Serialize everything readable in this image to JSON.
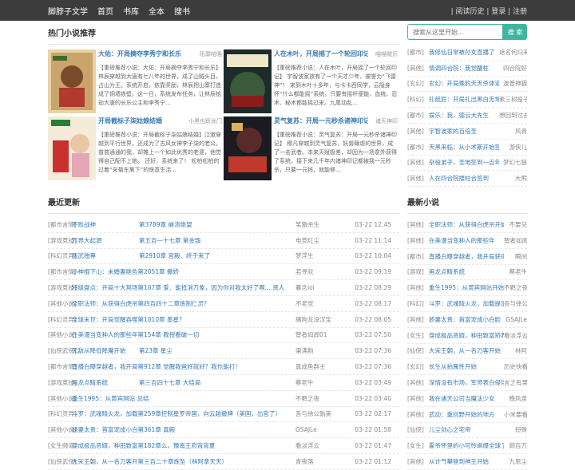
{
  "topbar": {
    "brand": "脚脖子文学",
    "nav": [
      "首页",
      "书库",
      "全本",
      "搜书"
    ],
    "right": "| 阅读历史 | 登录 | 注册"
  },
  "search": {
    "placeholder": "搜索从这里开始...",
    "button": "搜 索"
  },
  "hot": {
    "title": "热门小说推荐",
    "cards": [
      {
        "title": "大佑：开局摘夺李秀宁和长乐",
        "author": "吼罪哈晚",
        "desc": "【重磅推荐小说：大佑：开局摘夺李秀宁和长乐】 林辰穿越到大唐有七八年的世界，成了山贼头目，占山为王。系统开启，依靠奖励，林辰把山寨打造成了铜墙铁壁。这一日，系统发布任务，让林辰抢劫大唐的长乐公主和李秀宁..."
      },
      {
        "title": "人在木叶，开局摇了一个轮回印记",
        "author": "喵喵贼乐",
        "desc": "【重磅推荐小说：人在木叶，开局摇了一个轮回印记】 宇智波家族有了一个天才少年，被誉为“飞雷神”！ 来到木叶十多年，与卡卡西同学，云隐身怀“什么都能摇”系统，只要有摇杆便能，血统、忍术、秘术都能摇过来。九尾动乱..."
      },
      {
        "title": "开局截标子柒姑娘结婚",
        "author": "小黑也跃龙门",
        "desc": "【重磅推荐小说：开局截标子柒姑娘结婚】江澈穿越到平行世界，还成为了古风女神李子柒的老公。 普普通通的我，却摊上一个如此优秀的老婆，他觉得自己配不上她。 还好，系统来了！ 松柏松柏的过着“采菊东篱下”的惬意生活..."
      },
      {
        "title": "灵气复苏：开局一元秒杀诸神印记",
        "author": "诸天神印",
        "desc": "【重磅推荐小说：灵气复苏：开局一元秒杀诸神印记】 穆凡穿越到灵气复苏，妖兽肆虐的世界，成了一名武者。本来天赋极差，却因为一场意外获得了系统，接下来几千年内诸神印记都被我一元秒杀，只要一元钱，就能够..."
      }
    ]
  },
  "recent": {
    "title": "最近更新",
    "rows": [
      [
        "[都市言情]",
        "不败战神",
        "第3789章 崩溃绝望",
        "笑傲余生",
        "03-22 12:45"
      ],
      [
        "[游戏竞技]",
        "万界大起源",
        "第五百一十七章 第金毁",
        "电竞红尘",
        "03-22 11:14"
      ],
      [
        "[科幻灵异]",
        "医武独尊",
        "第2910章 宫殿、终于来了",
        "梦浮生",
        "03-22 10:04"
      ],
      [
        "[都市言情]",
        "小神棍下山：未婚妻绝色第2051章 撒娇",
        "",
        "若寻欢",
        "03-22 09:19"
      ],
      [
        "[游戏竞技]",
        "特级盘点：开局十大冥场第107章 爱、能抵消万象，因为你对我太好了啊....贤人",
        "",
        "暮念ioi",
        "03-22 08:29"
      ],
      [
        "[其他小说]",
        "全职法师：从获得白虎吊第四百四十二章炼制仁灵？",
        "",
        "不老觉",
        "03-22 08:17"
      ],
      [
        "[科幻灵异]",
        "全球末世：开局觉醒吞噬第1010章 墨星?",
        "",
        "猪狗龙没汉宝",
        "03-22 08:05"
      ],
      [
        "[其他小说]",
        "在美漫当变种人的那些年第154章 教授看破一切",
        "",
        "智者如闻01",
        "03-22 07:50"
      ],
      [
        "[仙侠武侠]",
        "无敌从降低降魔开始",
        "第23章 星尘",
        "渠沸韵",
        "03-22 07:36"
      ],
      [
        "[都市言情]",
        "直播白曝穿越者，我开局第912章 觉醒我爸好就好？我也能打！",
        "",
        "真成鱼群主",
        "03-22 07:36"
      ],
      [
        "[游戏竞技]",
        "画龙点睛系统",
        "第三百四十七章 大结局",
        "蔡老牛",
        "03-22 03:49"
      ],
      [
        "[其他小说]",
        "重生1995：从黄宾网站 总结",
        "",
        "不羁之夜",
        "03-22 03:40"
      ],
      [
        "[科幻灵异]",
        "斗罗：武魂晴火龙，加载第259章控制星罗帝国，向云越撤牌（美国，出宫了）",
        "",
        "吾与徐公孰美",
        "03-22 02:17"
      ],
      [
        "[其他小说]",
        "娇妻太贵：首富宠成小白第361章 真殿",
        "",
        "GSAJLe",
        "03-22 01:58"
      ],
      [
        "[女生频道]",
        "穿成极品恶婿，种田致富第182章么，豫南王府背背夏",
        "",
        "看淡浮云",
        "03-22 01:47"
      ],
      [
        "[仙侠武侠]",
        "大宋王朝，从一名刀客开第三百二十章炼坠（林阿拿天天）",
        "",
        "青夜落",
        "03-22 01:12"
      ]
    ]
  },
  "hotright": {
    "rows": [
      [
        "[都市]",
        "我修仙日常被孙女直播了",
        "遮名何归来"
      ],
      [
        "[其他]",
        "情调四合院：我觉醒柱",
        "四合院好"
      ],
      [
        "[玄幻]",
        "玄幻：开局乘豹天天杀体道胎",
        "波普神猫"
      ],
      [
        "[科幻]",
        "扎纸匠：开局扎出黑白无常",
        "素三树投子"
      ],
      [
        "[都市]",
        "娱乐：我，德云大先生",
        "想回到过去"
      ],
      [
        "[其他]",
        "宇智波家的百倍圣",
        "风青"
      ],
      [
        "[都市]",
        "天黑来临：从小术斯开始签到",
        "游侠儿"
      ],
      [
        "[其他]",
        "杂役弟子，圣地签到一百年!",
        "梦幻七狼"
      ],
      [
        "[其他]",
        "人在四合院搂柱合签到",
        "大熊"
      ]
    ]
  },
  "newnovels": {
    "title": "最新小说",
    "rows": [
      [
        "[其他]",
        "全职法师：从获得白虎吊开始",
        "不要兒"
      ],
      [
        "[其他]",
        "在美漫当变种人的那些年",
        "智者如闻01"
      ],
      [
        "[都市]",
        "直播白曝穿越者，我开局获得造物",
        "瞬间"
      ],
      [
        "[游戏]",
        "画龙点睛系统",
        "蔡老牛"
      ],
      [
        "[其他]",
        "重生1995：从黄宾网站开始",
        "不羁之夜"
      ],
      [
        "[科幻]",
        "斗罗：武魂晴火龙，加载提示语",
        "吾与徐公孰"
      ],
      [
        "[其他]",
        "娇妻太贵：首富宠成小白脸",
        "GSAJLe"
      ],
      [
        "[女生]",
        "穿成极品恶婿，种田致富矫养探花",
        "看淡浮云"
      ],
      [
        "[仙侠]",
        "大宋王朝，从一名刀客开始",
        "林阿"
      ],
      [
        "[玄幻]",
        "长生从拍属性开始",
        "历史快看人"
      ],
      [
        "[其他]",
        "深情没有市场，军师表白侵场",
        "言之有果"
      ],
      [
        "[其他]",
        "我在诸天公司当魔法少女",
        "晚风泉"
      ],
      [
        "[其他]",
        "武动：重回野开始的地方",
        "小米要看书"
      ],
      [
        "[仙侠]",
        "儿尘剑心之宅帝",
        "短殊"
      ],
      [
        "[女生]",
        "霍爷怀里的小可怜飒爆全球了",
        "顾百万"
      ],
      [
        "[其他]",
        "从计气攀登到神王开始",
        "九思尘"
      ]
    ]
  }
}
